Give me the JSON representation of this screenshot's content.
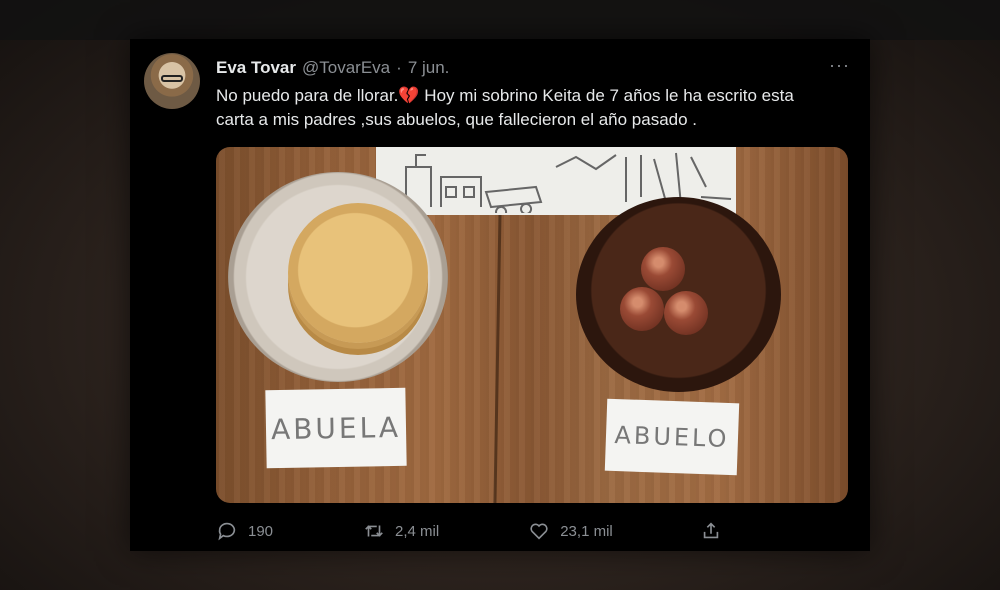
{
  "tweet": {
    "author_name": "Eva Tovar",
    "author_handle": "@TovarEva",
    "separator": "·",
    "date": "7 jun.",
    "more_label": "···",
    "text": "No puedo para de llorar.💔 Hoy mi sobrino Keita de 7 años le ha escrito esta carta a mis padres ,sus abuelos, que fallecieron el año pasado .",
    "photo": {
      "card_left_text": "ABUELA",
      "card_right_text": "ABUELO"
    },
    "actions": {
      "replies": "190",
      "retweets": "2,4 mil",
      "likes": "23,1 mil"
    },
    "icons": [
      "reply-icon",
      "retweet-icon",
      "like-icon",
      "share-icon",
      "more-icon"
    ]
  }
}
